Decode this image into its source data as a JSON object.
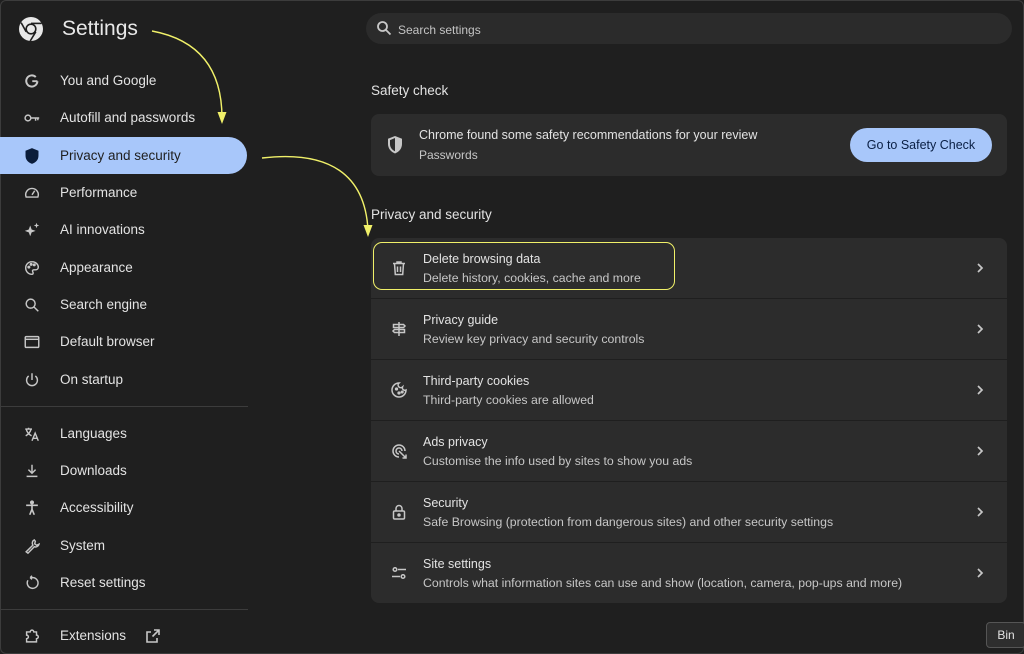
{
  "app": {
    "title": "Settings"
  },
  "sidebar": {
    "items": [
      {
        "label": "You and Google",
        "icon": "google-g-icon"
      },
      {
        "label": "Autofill and passwords",
        "icon": "key-icon"
      },
      {
        "label": "Privacy and security",
        "icon": "shield-icon",
        "active": true
      },
      {
        "label": "Performance",
        "icon": "speedometer-icon"
      },
      {
        "label": "AI innovations",
        "icon": "sparkle-icon"
      },
      {
        "label": "Appearance",
        "icon": "palette-icon"
      },
      {
        "label": "Search engine",
        "icon": "search-icon"
      },
      {
        "label": "Default browser",
        "icon": "browser-window-icon"
      },
      {
        "label": "On startup",
        "icon": "power-icon"
      },
      {
        "label": "Languages",
        "icon": "translate-icon"
      },
      {
        "label": "Downloads",
        "icon": "download-icon"
      },
      {
        "label": "Accessibility",
        "icon": "accessibility-icon"
      },
      {
        "label": "System",
        "icon": "wrench-icon"
      },
      {
        "label": "Reset settings",
        "icon": "reset-icon"
      },
      {
        "label": "Extensions",
        "icon": "puzzle-icon"
      }
    ]
  },
  "search": {
    "placeholder": "Search settings"
  },
  "safety": {
    "section_title": "Safety check",
    "message": "Chrome found some safety recommendations for your review",
    "sub": "Passwords",
    "button": "Go to Safety Check"
  },
  "privacy": {
    "section_title": "Privacy and security",
    "rows": [
      {
        "title": "Delete browsing data",
        "sub": "Delete history, cookies, cache and more",
        "icon": "trash-icon"
      },
      {
        "title": "Privacy guide",
        "sub": "Review key privacy and security controls",
        "icon": "signpost-icon"
      },
      {
        "title": "Third-party cookies",
        "sub": "Third-party cookies are allowed",
        "icon": "cookie-icon"
      },
      {
        "title": "Ads privacy",
        "sub": "Customise the info used by sites to show you ads",
        "icon": "ads-target-icon"
      },
      {
        "title": "Security",
        "sub": "Safe Browsing (protection from dangerous sites) and other security settings",
        "icon": "lock-icon"
      },
      {
        "title": "Site settings",
        "sub": "Controls what information sites can use and show (location, camera, pop-ups and more)",
        "icon": "sliders-icon"
      }
    ]
  },
  "tooltip": {
    "text": "Bin"
  },
  "colors": {
    "accent": "#a8c7fa",
    "annotation": "#f0f069",
    "background": "#1f1f1f",
    "card": "#2c2c2c"
  }
}
